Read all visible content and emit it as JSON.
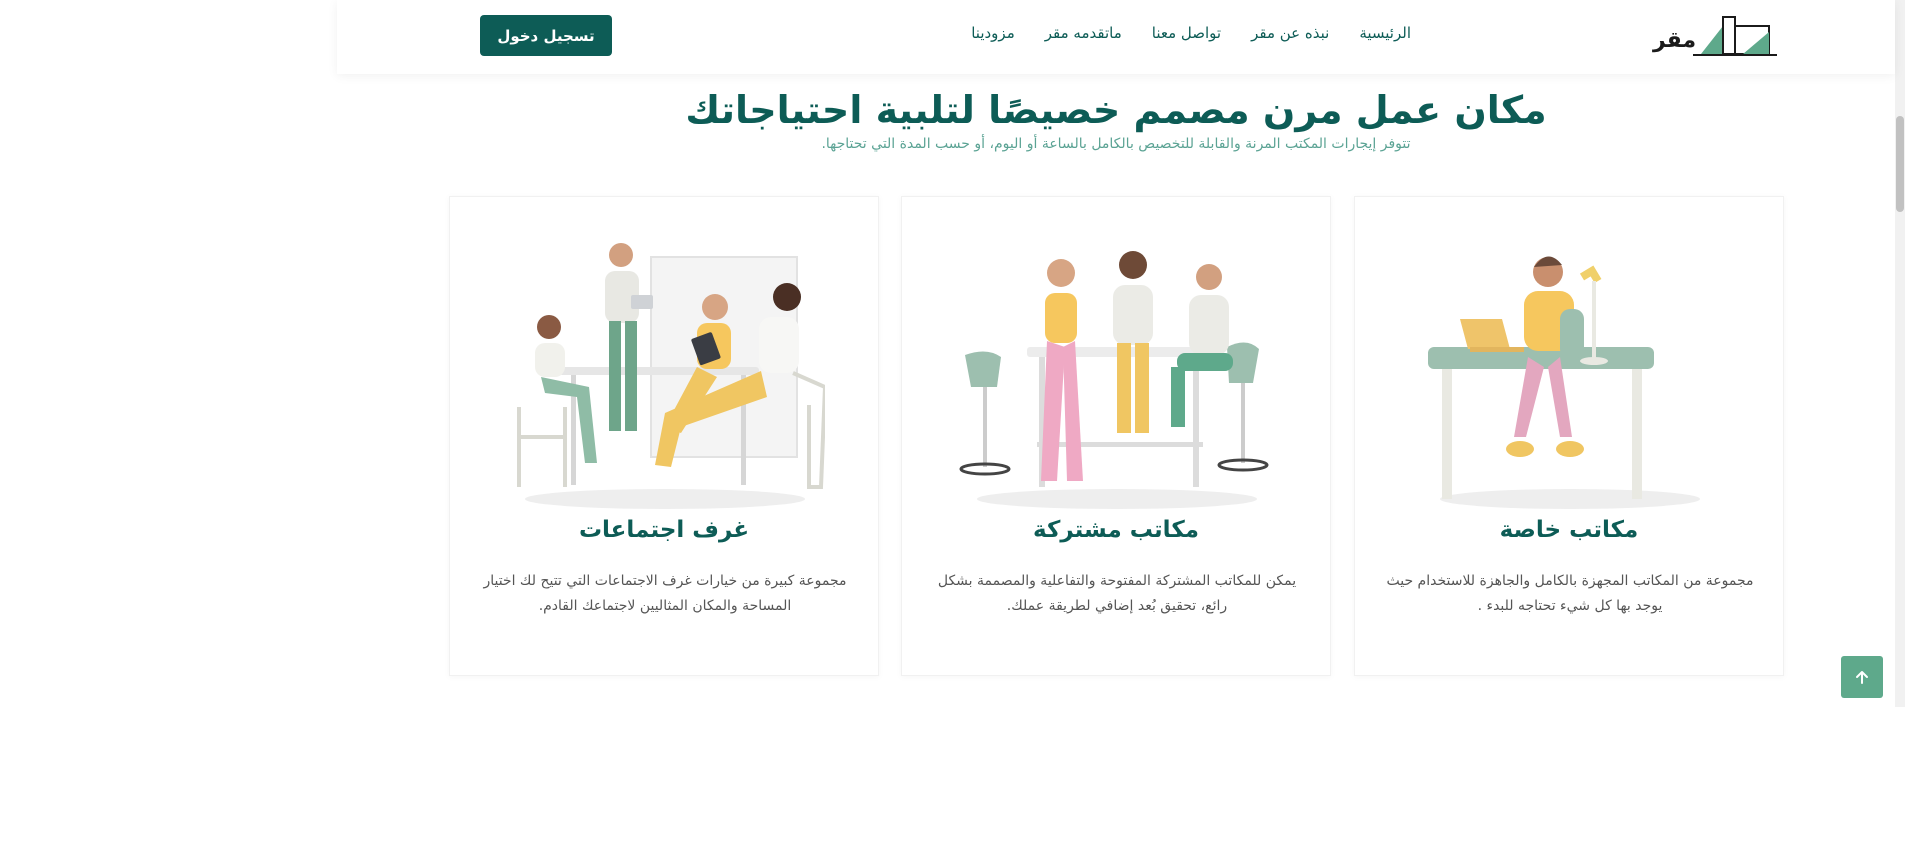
{
  "header": {
    "logo_text": "مقر",
    "nav": [
      "الرئيسية",
      "نبذه عن مقر",
      "تواصل معنا",
      "ماتقدمه مقر",
      "مزودينا"
    ],
    "login_label": "تسجيل دخول"
  },
  "hero": {
    "title": "مكان عمل مرن مصمم خصيصًا لتلبية احتياجاتك",
    "subtitle": "تتوفر إيجارات المكتب المرنة والقابلة للتخصيص بالكامل بالساعة أو اليوم، أو حسب المدة التي تحتاجها."
  },
  "cards": [
    {
      "title": "مكاتب خاصة",
      "description": "مجموعة من المكاتب المجهزة بالكامل والجاهزة للاستخدام حيث يوجد بها كل شيء تحتاجه للبدء ."
    },
    {
      "title": "مكاتب مشتركة",
      "description": "يمكن للمكاتب المشتركة المفتوحة والتفاعلية والمصممة بشكل رائع، تحقيق بُعد إضافي لطريقة عملك."
    },
    {
      "title": "غرف اجتماعات",
      "description": "مجموعة كبيرة من خيارات غرف الاجتماعات التي تتيح لك اختيار المساحة والمكان المثاليين لاجتماعك القادم."
    }
  ],
  "colors": {
    "primary": "#0d5c56",
    "accent": "#5ea98b",
    "subtitle": "#5ba394"
  },
  "icons": {
    "back_to_top": "arrow-up-icon"
  }
}
